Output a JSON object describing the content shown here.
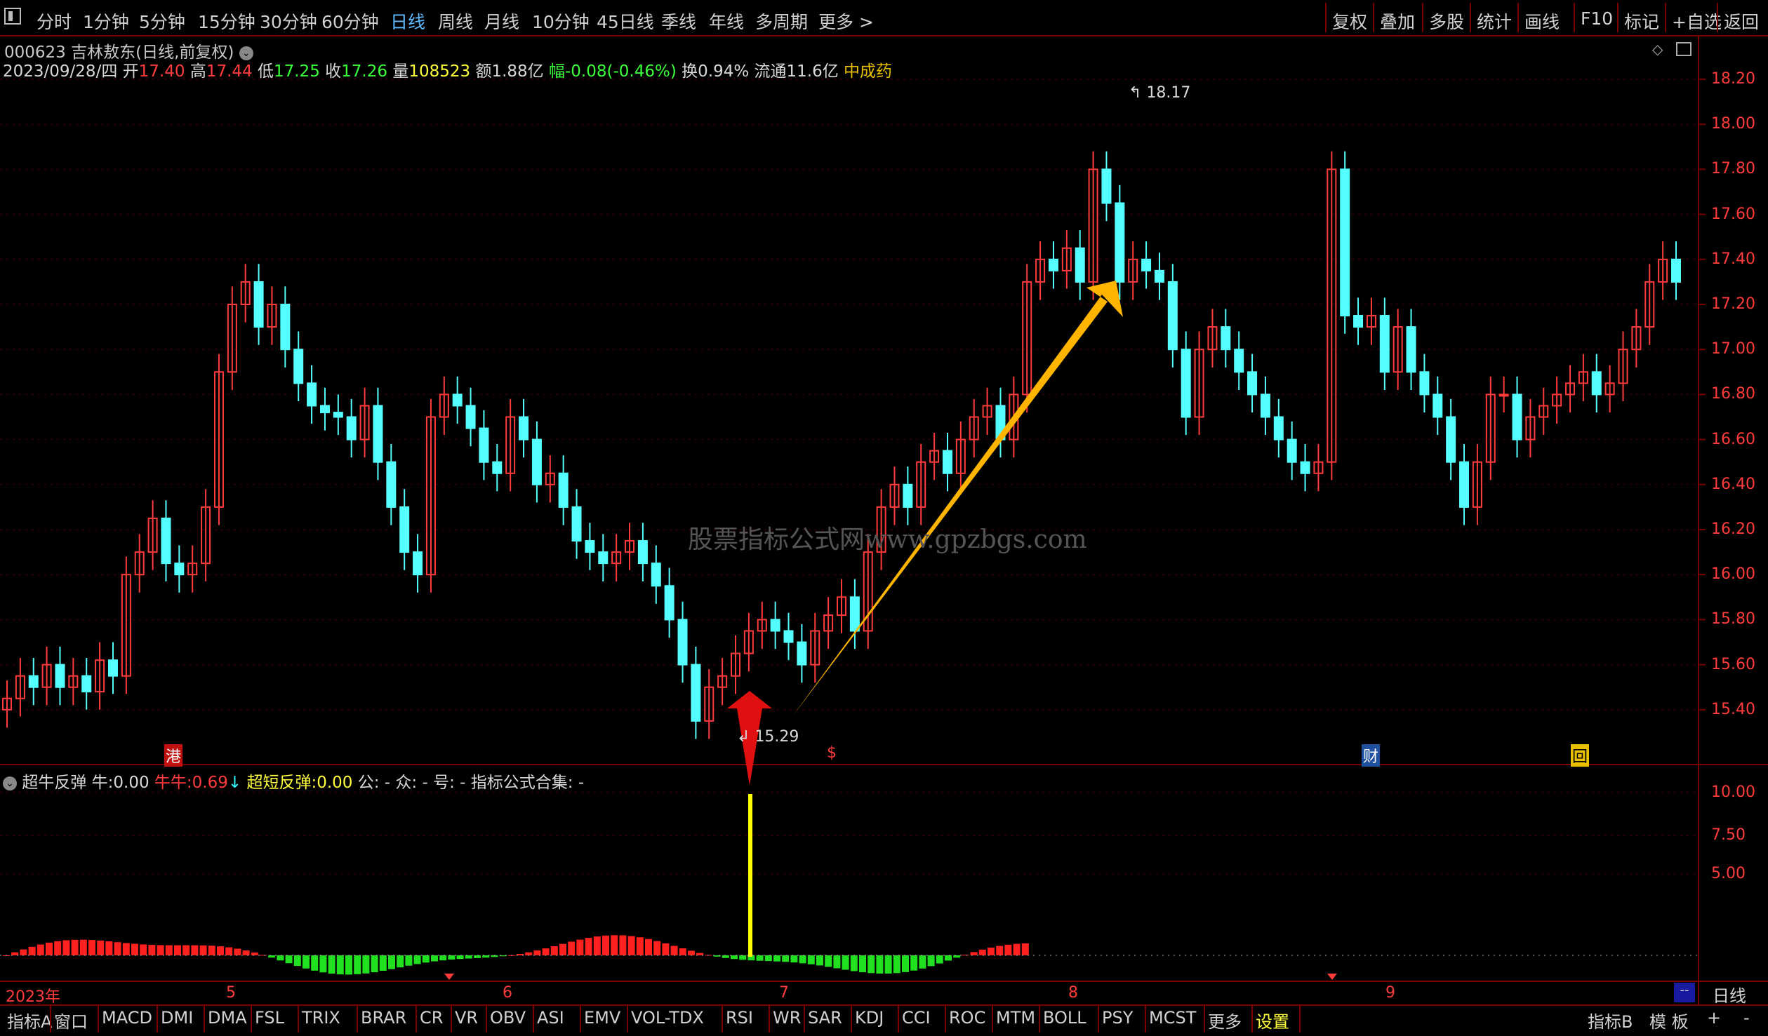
{
  "toolbar": {
    "periods": [
      "分时",
      "1分钟",
      "5分钟",
      "15分钟",
      "30分钟",
      "60分钟",
      "日线",
      "周线",
      "月线",
      "10分钟",
      "45日线",
      "季线",
      "年线",
      "多周期",
      "更多 >"
    ],
    "active_period": "日线",
    "tools": [
      "复权",
      "叠加",
      "多股",
      "统计",
      "画线",
      "F10",
      "标记",
      "+自选",
      "返回"
    ]
  },
  "stock": {
    "code_name": "000623 吉林敖东(日线,前复权)",
    "date": "2023/09/28/四",
    "open_label": "开",
    "open": "17.40",
    "high_label": "高",
    "high": "17.44",
    "low_label": "低",
    "low": "17.25",
    "close_label": "收",
    "close": "17.26",
    "vol_label": "量",
    "vol": "108523",
    "amount": "额1.88亿",
    "change": "幅-0.08(-0.46%)",
    "turnover": "换0.94%",
    "float": "流通11.6亿",
    "sector": "中成药"
  },
  "watermark": "股票指标公式网www.gpzbgs.com",
  "price_axis": [
    "18.20",
    "18.00",
    "17.80",
    "17.60",
    "17.40",
    "17.20",
    "17.00",
    "16.80",
    "16.60",
    "16.40",
    "16.20",
    "16.00",
    "15.80",
    "15.60",
    "15.40"
  ],
  "indicator_axis": [
    "10.00",
    "7.50",
    "5.00"
  ],
  "annotations": {
    "high_mark": "18.17",
    "low_mark": "15.29"
  },
  "event_markers": [
    "港",
    "$",
    "财",
    "回"
  ],
  "indicator": {
    "name": "超牛反弹",
    "niu_label": "牛:",
    "niu": "0.00",
    "niuniu_label": "牛牛:",
    "niuniu": "0.69",
    "super_label": "超短反弹:",
    "super": "0.00",
    "gong": "公: -",
    "zhong": "众: -",
    "hao": "号: -",
    "collection": "指标公式合集: -"
  },
  "x_axis": [
    "2023年",
    "5",
    "6",
    "7",
    "8",
    "9"
  ],
  "x_right_label": "日线",
  "tabs": [
    "指标A",
    "窗口",
    "MACD",
    "DMI",
    "DMA",
    "FSL",
    "TRIX",
    "BRAR",
    "CR",
    "VR",
    "OBV",
    "ASI",
    "EMV",
    "VOL-TDX",
    "RSI",
    "WR",
    "SAR",
    "KDJ",
    "CCI",
    "ROC",
    "MTM",
    "BOLL",
    "PSY",
    "MCST",
    "更多",
    "设置"
  ],
  "right_tabs": [
    "指标B",
    "模 板",
    "+",
    "-"
  ],
  "colors": {
    "up": "#ff3b3b",
    "down": "#54ffff",
    "frame": "#7a0000",
    "arrow": "#ffb400"
  }
}
